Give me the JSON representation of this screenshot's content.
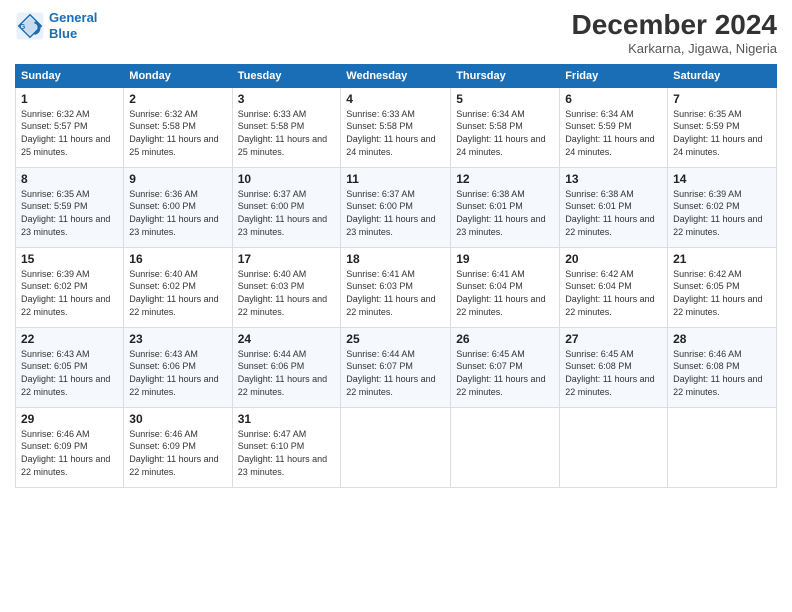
{
  "logo": {
    "line1": "General",
    "line2": "Blue"
  },
  "header": {
    "month": "December 2024",
    "location": "Karkarna, Jigawa, Nigeria"
  },
  "weekdays": [
    "Sunday",
    "Monday",
    "Tuesday",
    "Wednesday",
    "Thursday",
    "Friday",
    "Saturday"
  ],
  "weeks": [
    [
      {
        "day": "1",
        "sunrise": "6:32 AM",
        "sunset": "5:57 PM",
        "daylight": "11 hours and 25 minutes."
      },
      {
        "day": "2",
        "sunrise": "6:32 AM",
        "sunset": "5:58 PM",
        "daylight": "11 hours and 25 minutes."
      },
      {
        "day": "3",
        "sunrise": "6:33 AM",
        "sunset": "5:58 PM",
        "daylight": "11 hours and 25 minutes."
      },
      {
        "day": "4",
        "sunrise": "6:33 AM",
        "sunset": "5:58 PM",
        "daylight": "11 hours and 24 minutes."
      },
      {
        "day": "5",
        "sunrise": "6:34 AM",
        "sunset": "5:58 PM",
        "daylight": "11 hours and 24 minutes."
      },
      {
        "day": "6",
        "sunrise": "6:34 AM",
        "sunset": "5:59 PM",
        "daylight": "11 hours and 24 minutes."
      },
      {
        "day": "7",
        "sunrise": "6:35 AM",
        "sunset": "5:59 PM",
        "daylight": "11 hours and 24 minutes."
      }
    ],
    [
      {
        "day": "8",
        "sunrise": "6:35 AM",
        "sunset": "5:59 PM",
        "daylight": "11 hours and 23 minutes."
      },
      {
        "day": "9",
        "sunrise": "6:36 AM",
        "sunset": "6:00 PM",
        "daylight": "11 hours and 23 minutes."
      },
      {
        "day": "10",
        "sunrise": "6:37 AM",
        "sunset": "6:00 PM",
        "daylight": "11 hours and 23 minutes."
      },
      {
        "day": "11",
        "sunrise": "6:37 AM",
        "sunset": "6:00 PM",
        "daylight": "11 hours and 23 minutes."
      },
      {
        "day": "12",
        "sunrise": "6:38 AM",
        "sunset": "6:01 PM",
        "daylight": "11 hours and 23 minutes."
      },
      {
        "day": "13",
        "sunrise": "6:38 AM",
        "sunset": "6:01 PM",
        "daylight": "11 hours and 22 minutes."
      },
      {
        "day": "14",
        "sunrise": "6:39 AM",
        "sunset": "6:02 PM",
        "daylight": "11 hours and 22 minutes."
      }
    ],
    [
      {
        "day": "15",
        "sunrise": "6:39 AM",
        "sunset": "6:02 PM",
        "daylight": "11 hours and 22 minutes."
      },
      {
        "day": "16",
        "sunrise": "6:40 AM",
        "sunset": "6:02 PM",
        "daylight": "11 hours and 22 minutes."
      },
      {
        "day": "17",
        "sunrise": "6:40 AM",
        "sunset": "6:03 PM",
        "daylight": "11 hours and 22 minutes."
      },
      {
        "day": "18",
        "sunrise": "6:41 AM",
        "sunset": "6:03 PM",
        "daylight": "11 hours and 22 minutes."
      },
      {
        "day": "19",
        "sunrise": "6:41 AM",
        "sunset": "6:04 PM",
        "daylight": "11 hours and 22 minutes."
      },
      {
        "day": "20",
        "sunrise": "6:42 AM",
        "sunset": "6:04 PM",
        "daylight": "11 hours and 22 minutes."
      },
      {
        "day": "21",
        "sunrise": "6:42 AM",
        "sunset": "6:05 PM",
        "daylight": "11 hours and 22 minutes."
      }
    ],
    [
      {
        "day": "22",
        "sunrise": "6:43 AM",
        "sunset": "6:05 PM",
        "daylight": "11 hours and 22 minutes."
      },
      {
        "day": "23",
        "sunrise": "6:43 AM",
        "sunset": "6:06 PM",
        "daylight": "11 hours and 22 minutes."
      },
      {
        "day": "24",
        "sunrise": "6:44 AM",
        "sunset": "6:06 PM",
        "daylight": "11 hours and 22 minutes."
      },
      {
        "day": "25",
        "sunrise": "6:44 AM",
        "sunset": "6:07 PM",
        "daylight": "11 hours and 22 minutes."
      },
      {
        "day": "26",
        "sunrise": "6:45 AM",
        "sunset": "6:07 PM",
        "daylight": "11 hours and 22 minutes."
      },
      {
        "day": "27",
        "sunrise": "6:45 AM",
        "sunset": "6:08 PM",
        "daylight": "11 hours and 22 minutes."
      },
      {
        "day": "28",
        "sunrise": "6:46 AM",
        "sunset": "6:08 PM",
        "daylight": "11 hours and 22 minutes."
      }
    ],
    [
      {
        "day": "29",
        "sunrise": "6:46 AM",
        "sunset": "6:09 PM",
        "daylight": "11 hours and 22 minutes."
      },
      {
        "day": "30",
        "sunrise": "6:46 AM",
        "sunset": "6:09 PM",
        "daylight": "11 hours and 22 minutes."
      },
      {
        "day": "31",
        "sunrise": "6:47 AM",
        "sunset": "6:10 PM",
        "daylight": "11 hours and 23 minutes."
      },
      null,
      null,
      null,
      null
    ]
  ]
}
